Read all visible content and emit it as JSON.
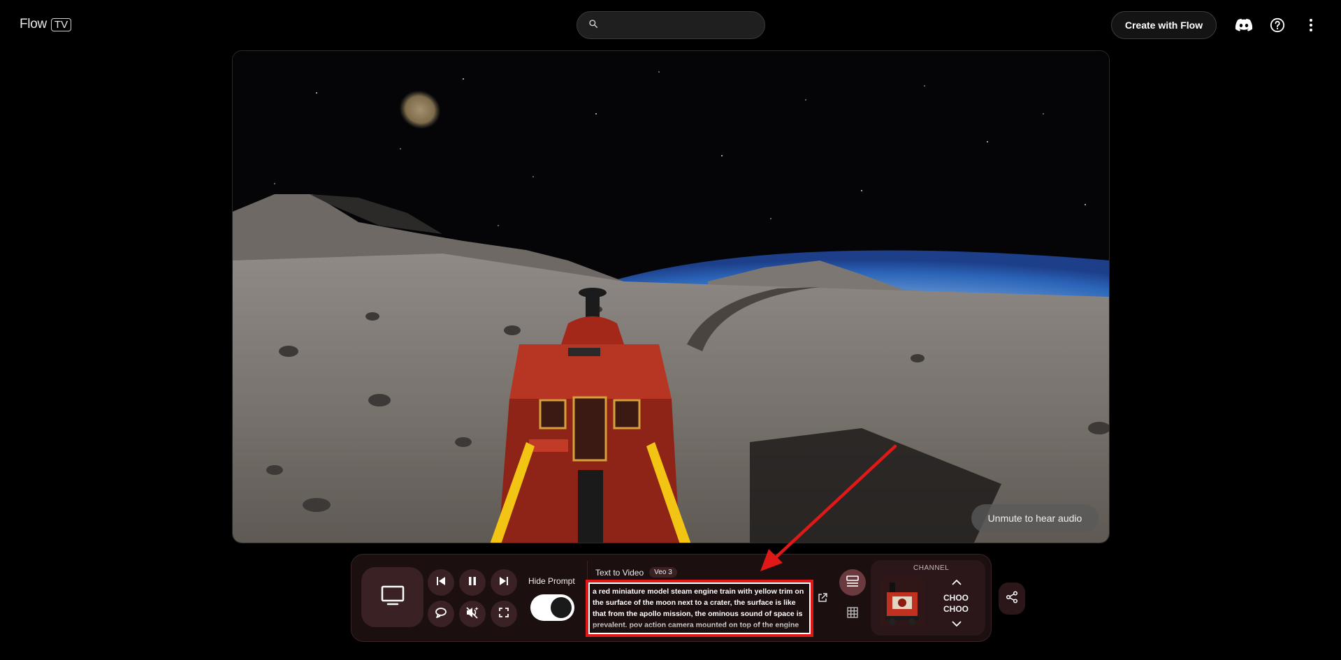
{
  "header": {
    "logo_text": "Flow",
    "logo_badge": "TV",
    "search": {
      "value": "",
      "placeholder": ""
    },
    "create_button": "Create with Flow",
    "icons": [
      "discord-icon",
      "help-icon",
      "more-vert-icon"
    ]
  },
  "video": {
    "unmute_label": "Unmute to hear audio"
  },
  "controls": {
    "hide_prompt_label": "Hide Prompt",
    "hide_prompt_on": true,
    "buttons": [
      "tv-icon",
      "skip-previous-icon",
      "pause-icon",
      "skip-next-icon",
      "loop-icon",
      "mute-icon",
      "fullscreen-icon"
    ]
  },
  "prompt": {
    "mode": "Text to Video",
    "model": "Veo 3",
    "text": "a red miniature model steam engine train with yellow trim on the surface of the moon next to a crater, the surface is like that from the apollo mission, the ominous sound of space is prevalent. pov action camera mounted on top of the engine"
  },
  "channel": {
    "label": "CHANNEL",
    "name": "CHOO CHOO"
  },
  "colors": {
    "bar_bg": "#1c0f10",
    "button_bg": "#3a2224",
    "highlight": "#e01818"
  }
}
